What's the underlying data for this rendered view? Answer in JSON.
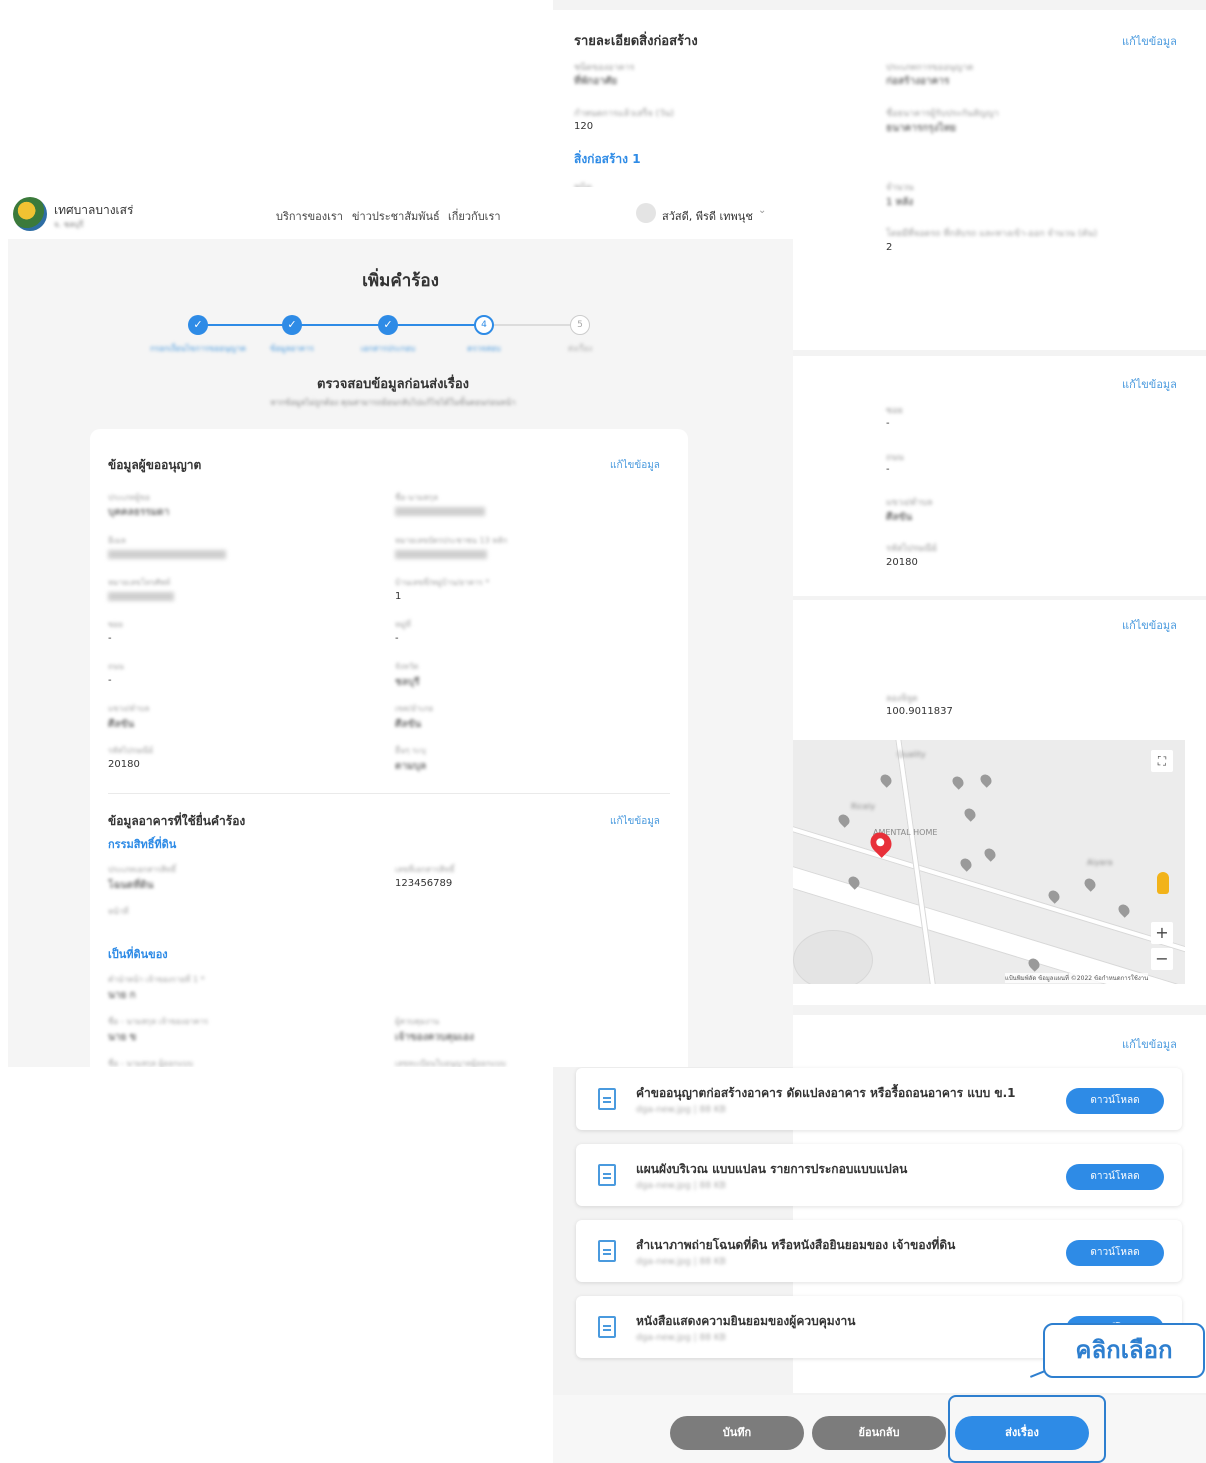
{
  "construction": {
    "title": "รายละเอียดสิ่งก่อสร้าง",
    "edit": "แก้ไขข้อมูล",
    "fields": [
      {
        "label": "ชนิดของอาคาร",
        "value": "ที่พักอาศัย"
      },
      {
        "label": "ประเภทการขออนุญาต",
        "value": "ก่อสร้างอาคาร"
      },
      {
        "label": "กำหนดการแล้วเสร็จ (วัน)",
        "value": "120"
      },
      {
        "label": "ชื่อธนาคารผู้รับประกันสัญญา",
        "value": "ธนาคารกรุงไทย"
      }
    ],
    "building_link": "สิ่งก่อสร้าง 1",
    "b_fields": [
      {
        "label": "ชนิด",
        "value": ""
      },
      {
        "label": "จำนวน",
        "value": "1 หลัง"
      },
      {
        "label": "โดยมีที่จอดรถ ที่กลับรถ และทางเข้า-ออก จำนวน (คัน)",
        "value": "2"
      }
    ]
  },
  "address_section": {
    "edit": "แก้ไขข้อมูล",
    "fields": [
      {
        "label": "ซอย",
        "value": "-"
      },
      {
        "label": "ถนน",
        "value": "-"
      },
      {
        "label": "แขวง/ตำบล",
        "value": "ศีลขัน"
      },
      {
        "label": "รหัสไปรษณีย์",
        "value": "20180"
      }
    ]
  },
  "location": {
    "edit": "แก้ไขข้อมูล",
    "lng_label": "ลองจิจูด",
    "lng_value": "100.9011837",
    "pin_label": "AMENTAL HOME",
    "attribution": "แป้นพิมพ์ลัด   ข้อมูลแผนที่ ©2022   ข้อกำหนดการใช้งาน"
  },
  "documents": {
    "edit": "แก้ไขข้อมูล",
    "view_label": "ดาวน์โหลด",
    "items": [
      {
        "title": "คำขออนุญาตก่อสร้างอาคาร ดัดแปลงอาคาร หรือรื้อถอนอาคาร แบบ ข.1",
        "meta": "dga-new.jpg | 88 KB"
      },
      {
        "title": "แผนผังบริเวณ แบบแปลน รายการประกอบแบบแปลน",
        "meta": "dga-new.jpg | 88 KB"
      },
      {
        "title": "สำเนาภาพถ่ายโฉนดที่ดิน หรือหนังสือยินยอมของ เจ้าของที่ดิน",
        "meta": "dga-new.jpg | 88 KB"
      },
      {
        "title": "หนังสือแสดงความยินยอมของผู้ควบคุมงาน",
        "meta": "dga-new.jpg | 88 KB"
      }
    ]
  },
  "buttons": {
    "save": "บันทึก",
    "back": "ย้อนกลับ",
    "submit": "ส่งเรื่อง"
  },
  "callout": "คลิกเลือก",
  "header": {
    "org_name": "เทศบาลบางเสร่",
    "org_sub": "จ. ชลบุรี",
    "nav": [
      "บริการของเรา",
      "ข่าวประชาสัมพันธ์",
      "เกี่ยวกับเรา"
    ],
    "greeting": "สวัสดี, พีรดี เทพนุช"
  },
  "page_title": "เพิ่มคำร้อง",
  "steps": [
    {
      "label": "กรอกเงื่อนไขการขออนุญาต",
      "state": "done"
    },
    {
      "label": "ข้อมูลอาคาร",
      "state": "done"
    },
    {
      "label": "เอกสารประกอบ",
      "state": "done"
    },
    {
      "label": "ตรวจสอบ",
      "state": "current",
      "num": "4"
    },
    {
      "label": "ส่งเรื่อง",
      "state": "todo",
      "num": "5"
    }
  ],
  "review": {
    "title": "ตรวจสอบข้อมูลก่อนส่งเรื่อง",
    "subtitle": "หากข้อมูลไม่ถูกต้อง คุณสามารถย้อนกลับไปแก้ไขได้ในขั้นตอนก่อนหน้า"
  },
  "applicant": {
    "title": "ข้อมูลผู้ขออนุญาต",
    "edit": "แก้ไขข้อมูล",
    "fields": [
      {
        "label": "ประเภทผู้ขอ",
        "value": "บุคคลธรรมดา"
      },
      {
        "label": "ชื่อ-นามสกุล",
        "value": ""
      },
      {
        "label": "อีเมล",
        "value": ""
      },
      {
        "label": "หมายเลขบัตรประชาชน 13 หลัก",
        "value": ""
      },
      {
        "label": "หมายเลขโทรศัพท์",
        "value": ""
      },
      {
        "label": "บ้านเลขที่/หมู่บ้าน/อาคาร *",
        "value": "1"
      },
      {
        "label": "ซอย",
        "value": "-"
      },
      {
        "label": "หมู่ที่",
        "value": "-"
      },
      {
        "label": "ถนน",
        "value": "-"
      },
      {
        "label": "จังหวัด",
        "value": "ชลบุรี"
      },
      {
        "label": "แขวง/ตำบล",
        "value": "ศีลขัน"
      },
      {
        "label": "เขต/อำเภอ",
        "value": "ศีลขัน"
      },
      {
        "label": "รหัสไปรษณีย์",
        "value": "20180"
      },
      {
        "label": "อื่นๆ ระบุ",
        "value": "ตามบุล"
      }
    ]
  },
  "building_request": {
    "title": "ข้อมูลอาคารที่ใช้ยื่นคำร้อง",
    "edit": "แก้ไขข้อมูล",
    "land_title": "กรรมสิทธิ์ที่ดิน",
    "fields": [
      {
        "label": "ประเภทเอกสารสิทธิ์",
        "value": "โฉนดที่ดิน"
      },
      {
        "label": "เลขที่เอกสารสิทธิ์",
        "value": "123456789"
      },
      {
        "label": "หน้าที่",
        "value": ""
      }
    ],
    "owner_title": "เป็นที่ดินของ",
    "owner_fields": [
      {
        "label": "คำนำหน้า เจ้าของรายที่ 1 *",
        "value": "นาย ก"
      },
      {
        "label": "ชื่อ - นามสกุล เจ้าของอาคาร",
        "value": "นาย ข"
      },
      {
        "label": "ผู้ควบคุมงาน",
        "value": "เจ้าของควบคุมเอง"
      },
      {
        "label": "ชื่อ - นามสกุล ผู้ออกแบบ",
        "value": ""
      },
      {
        "label": "เลขทะเบียนใบอนุญาตผู้ออกแบบ",
        "value": ""
      }
    ]
  }
}
